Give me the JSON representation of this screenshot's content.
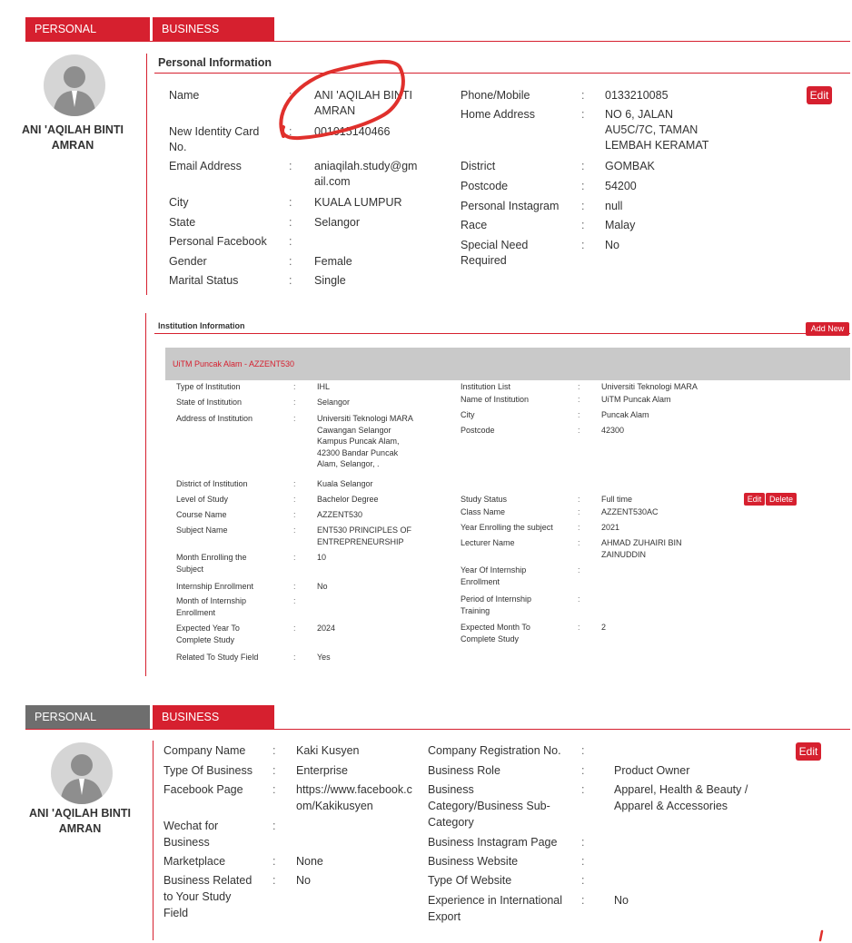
{
  "tabs": {
    "personal": "PERSONAL PROFILE",
    "business": "BUSINESS PROFILE"
  },
  "user": {
    "name_line1": "ANI 'AQILAH BINTI",
    "name_line2": "AMRAN"
  },
  "personal": {
    "title": "Personal Information",
    "edit_label": "Edit",
    "left": [
      {
        "label": "Name",
        "value_lines": [
          "ANI 'AQILAH BINTI",
          "AMRAN"
        ]
      },
      {
        "label_lines": [
          "New Identity Card",
          "No."
        ],
        "value_lines": [
          "001015140466"
        ]
      },
      {
        "label": "Email Address",
        "value_lines": [
          "aniaqilah.study@gm",
          "ail.com"
        ]
      },
      {
        "label": "City",
        "value_lines": [
          "KUALA LUMPUR"
        ]
      },
      {
        "label": "State",
        "value_lines": [
          "Selangor"
        ]
      },
      {
        "label": "Personal Facebook",
        "value_lines": [
          ""
        ]
      },
      {
        "label": "Gender",
        "value_lines": [
          "Female"
        ]
      },
      {
        "label": "Marital Status",
        "value_lines": [
          "Single"
        ]
      }
    ],
    "right": [
      {
        "label": "Phone/Mobile",
        "value_lines": [
          "0133210085"
        ]
      },
      {
        "label": "Home Address",
        "value_lines": [
          "NO 6, JALAN",
          "AU5C/7C, TAMAN",
          "LEMBAH KERAMAT"
        ]
      },
      {
        "label": "District",
        "value_lines": [
          "GOMBAK"
        ]
      },
      {
        "label": "Postcode",
        "value_lines": [
          "54200"
        ]
      },
      {
        "label": "Personal Instagram",
        "value_lines": [
          "null"
        ]
      },
      {
        "label": "Race",
        "value_lines": [
          "Malay"
        ]
      },
      {
        "label_lines": [
          "Special Need",
          "Required"
        ],
        "value_lines": [
          "No"
        ]
      }
    ]
  },
  "institution": {
    "title": "Institution Information",
    "add_new_label": "Add New",
    "header": "UiTM Puncak Alam - AZZENT530",
    "edit_label": "Edit",
    "delete_label": "Delete",
    "left": [
      {
        "label_lines": [
          "Type of Institution"
        ],
        "value_lines": [
          "IHL"
        ]
      },
      {
        "label_lines": [
          "State of Institution"
        ],
        "value_lines": [
          "Selangor"
        ]
      },
      {
        "label_lines": [
          "Address of Institution"
        ],
        "value_lines": [
          "Universiti Teknologi MARA",
          "Cawangan Selangor",
          "Kampus Puncak Alam,",
          "42300 Bandar Puncak",
          "Alam, Selangor, ."
        ]
      },
      {
        "label_lines": [
          "District of Institution"
        ],
        "value_lines": [
          "Kuala Selangor"
        ]
      },
      {
        "label_lines": [
          "Level of Study"
        ],
        "value_lines": [
          "Bachelor Degree"
        ]
      },
      {
        "label_lines": [
          "Course Name"
        ],
        "value_lines": [
          "AZZENT530"
        ]
      },
      {
        "label_lines": [
          "Subject Name"
        ],
        "value_lines": [
          "ENT530 PRINCIPLES OF",
          "ENTREPRENEURSHIP"
        ]
      },
      {
        "label_lines": [
          "Month Enrolling the",
          "Subject"
        ],
        "value_lines": [
          "10"
        ]
      },
      {
        "label_lines": [
          "Internship Enrollment"
        ],
        "value_lines": [
          "No"
        ]
      },
      {
        "label_lines": [
          "Month of Internship",
          "Enrollment"
        ],
        "value_lines": [
          ""
        ]
      },
      {
        "label_lines": [
          "Expected Year To",
          "Complete Study"
        ],
        "value_lines": [
          "2024"
        ]
      },
      {
        "label_lines": [
          "Related To Study Field"
        ],
        "value_lines": [
          "Yes"
        ]
      }
    ],
    "right": [
      {
        "label_lines": [
          "Institution List"
        ],
        "value_lines": [
          "Universiti Teknologi MARA"
        ]
      },
      {
        "label_lines": [
          "Name of Institution"
        ],
        "value_lines": [
          "UiTM Puncak Alam"
        ]
      },
      {
        "label_lines": [
          "City"
        ],
        "value_lines": [
          "Puncak Alam"
        ]
      },
      {
        "label_lines": [
          "Postcode"
        ],
        "value_lines": [
          "42300"
        ]
      },
      {
        "label_lines": [
          "Study Status"
        ],
        "value_lines": [
          "Full time"
        ]
      },
      {
        "label_lines": [
          "Class Name"
        ],
        "value_lines": [
          "AZZENT530AC"
        ]
      },
      {
        "label_lines": [
          "Year Enrolling the subject"
        ],
        "value_lines": [
          "2021"
        ]
      },
      {
        "label_lines": [
          "Lecturer Name"
        ],
        "value_lines": [
          "AHMAD ZUHAIRI BIN",
          "ZAINUDDIN"
        ]
      },
      {
        "label_lines": [
          "Year Of Internship",
          "Enrollment"
        ],
        "value_lines": [
          ""
        ]
      },
      {
        "label_lines": [
          "Period of Internship",
          "Training"
        ],
        "value_lines": [
          ""
        ]
      },
      {
        "label_lines": [
          "Expected Month To",
          "Complete Study"
        ],
        "value_lines": [
          "2"
        ]
      }
    ]
  },
  "business": {
    "edit_label": "Edit",
    "left": [
      {
        "label_lines": [
          "Company Name"
        ],
        "value_lines": [
          "Kaki Kusyen"
        ]
      },
      {
        "label_lines": [
          "Type Of Business"
        ],
        "value_lines": [
          "Enterprise"
        ]
      },
      {
        "label_lines": [
          "Facebook Page"
        ],
        "value_lines": [
          "https://www.facebook.c",
          "om/Kakikusyen"
        ]
      },
      {
        "label_lines": [
          "Wechat for",
          "Business"
        ],
        "value_lines": [
          ""
        ]
      },
      {
        "label_lines": [
          "Marketplace"
        ],
        "value_lines": [
          "None"
        ]
      },
      {
        "label_lines": [
          "Business Related",
          "to Your Study",
          "Field"
        ],
        "value_lines": [
          "No"
        ]
      }
    ],
    "right": [
      {
        "label_lines": [
          "Company Registration No."
        ],
        "value_lines": [
          ""
        ]
      },
      {
        "label_lines": [
          "Business Role"
        ],
        "value_lines": [
          "Product Owner"
        ]
      },
      {
        "label_lines": [
          "Business",
          "Category/Business Sub-",
          "Category"
        ],
        "value_lines": [
          "Apparel, Health & Beauty /",
          "Apparel & Accessories"
        ]
      },
      {
        "label_lines": [
          "Business Instagram Page"
        ],
        "value_lines": [
          ""
        ]
      },
      {
        "label_lines": [
          "Business Website"
        ],
        "value_lines": [
          ""
        ]
      },
      {
        "label_lines": [
          "Type Of Website"
        ],
        "value_lines": [
          ""
        ]
      },
      {
        "label_lines": [
          "Experience in International",
          "Export"
        ],
        "value_lines": [
          "No"
        ]
      }
    ]
  },
  "colors": {
    "accent": "#d6202f",
    "tab_inactive": "#6e6e6e",
    "inst_header": "#c9c9c9"
  },
  "icons": [
    "user-avatar-icon"
  ]
}
